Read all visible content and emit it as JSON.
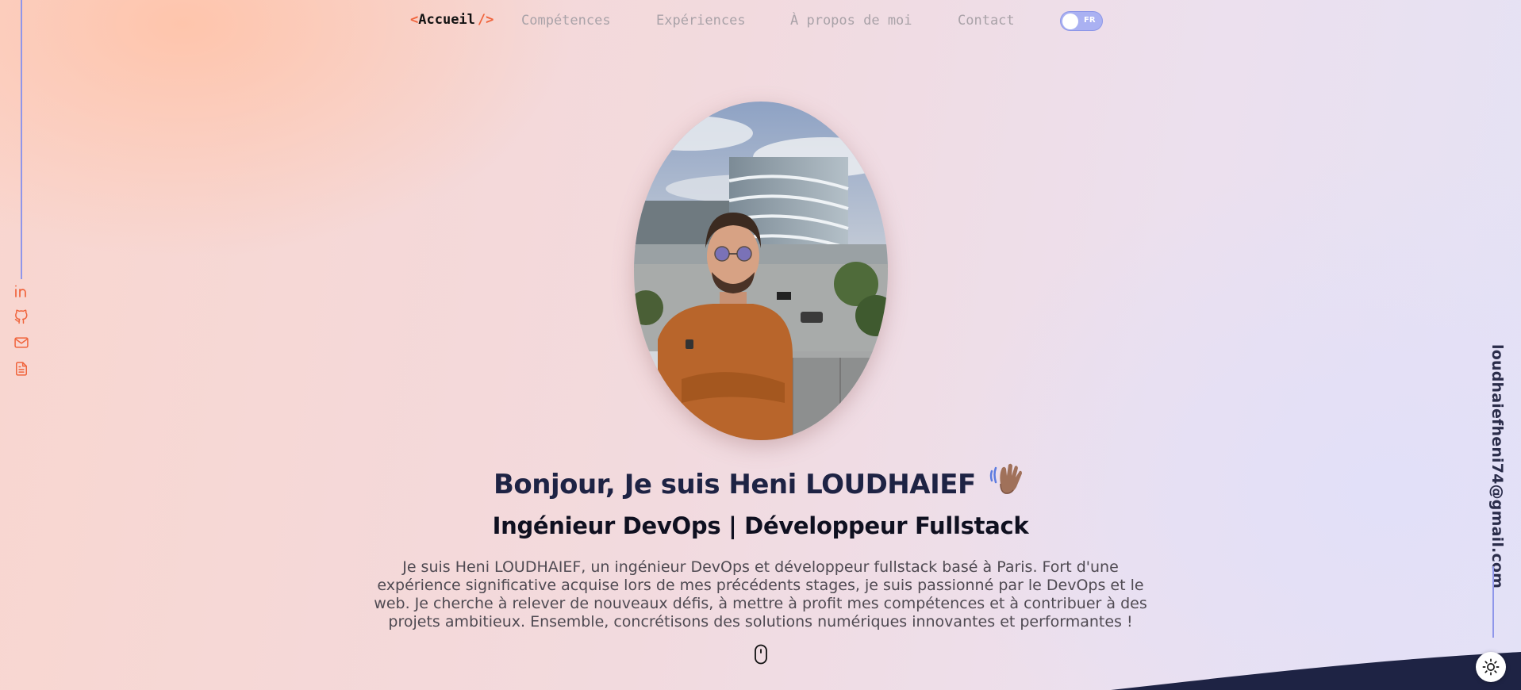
{
  "nav": {
    "home_open": "<",
    "home_label": "Accueil",
    "home_close": "/>",
    "links": [
      "Compétences",
      "Expériences",
      "À propos de moi",
      "Contact"
    ],
    "lang_label": "FR"
  },
  "social": {
    "icons": [
      "linkedin-icon",
      "github-icon",
      "mail-icon",
      "document-icon"
    ]
  },
  "email": "loudhaiefheni74@gmail.com",
  "hero": {
    "title": "Bonjour, Je suis Heni LOUDHAIEF",
    "subtitle": "Ingénieur DevOps | Développeur Fullstack",
    "description": "Je suis Heni LOUDHAIEF, un ingénieur DevOps et développeur fullstack basé à Paris. Fort d'une expérience significative acquise lors de mes précédents stages, je suis passionné par le DevOps et le web. Je cherche à relever de nouveaux défis, à mettre à profit mes compétences et à contribuer à des projets ambitieux. Ensemble, concrétisons des solutions numériques innovantes et performantes !"
  },
  "colors": {
    "accent": "#f0643c",
    "line": "#8f96ea",
    "title": "#1e2344"
  }
}
